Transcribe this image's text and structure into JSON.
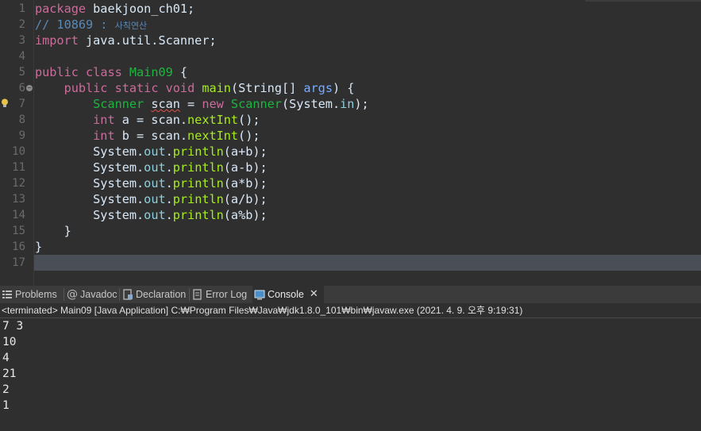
{
  "editor": {
    "line_numbers": [
      "1",
      "2",
      "3",
      "4",
      "5",
      "6",
      "7",
      "8",
      "9",
      "10",
      "11",
      "12",
      "13",
      "14",
      "15",
      "16",
      "17"
    ],
    "tokens": {
      "package_kw": "package",
      "package_name": " baekjoon_ch01;",
      "comment": "// 10869 : ",
      "comment_korean": "사칙연산",
      "import_kw": "import",
      "import_name": " java.util.Scanner;",
      "public": "public",
      "class": "class",
      "class_name": "Main09",
      "brace_open": " {",
      "static": "static",
      "void": "void",
      "main": "main",
      "string_arr": "(String[] ",
      "args": "args",
      "args_close": ") {",
      "scanner_type": "Scanner",
      "scan_var": "scan",
      "eq_new": " = ",
      "new": "new",
      "scanner_ctor": " Scanner",
      "system_in_open": "(System.",
      "in": "in",
      "close_semi": ");",
      "int": "int",
      "a_assign": " a = scan.",
      "b_assign": " b = scan.",
      "nextInt": "nextInt",
      "call_end": "();",
      "system": "System.",
      "out": "out",
      "dot": ".",
      "println": "println",
      "arg_add": "(a+b);",
      "arg_sub": "(a-b);",
      "arg_mul": "(a*b);",
      "arg_div": "(a/b);",
      "arg_mod": "(a%b);",
      "close_brace_inner": "    }",
      "close_brace_outer": "}"
    }
  },
  "tabs": [
    {
      "label": "Problems"
    },
    {
      "label": "Javadoc"
    },
    {
      "label": "Declaration"
    },
    {
      "label": "Error Log"
    },
    {
      "label": "Console"
    }
  ],
  "console": {
    "status": "<terminated> Main09 [Java Application] C:₩Program Files₩Java₩jdk1.8.0_101₩bin₩javaw.exe (2021. 4. 9. 오후 9:19:31)",
    "output_lines": [
      "7 3",
      "10",
      "4",
      "21",
      "2",
      "1"
    ]
  },
  "colors": {
    "background": "#2f2f2f",
    "keyword": "#cc6c9c",
    "comment": "#5a89b5",
    "type": "#1eb540",
    "method": "#a7ec21",
    "field": "#8dd0dc"
  }
}
